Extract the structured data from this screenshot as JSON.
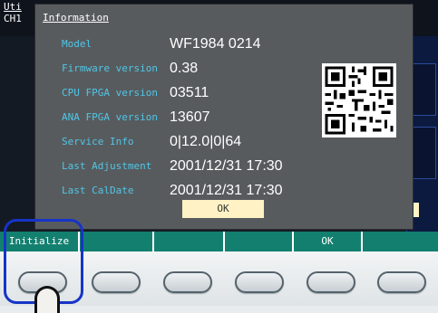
{
  "app": {
    "title": "Uti",
    "channel": "CH1"
  },
  "dialog": {
    "title": "Information",
    "rows": [
      {
        "label": "Model",
        "value": "WF1984  0214"
      },
      {
        "label": "Firmware version",
        "value": "0.38"
      },
      {
        "label": "CPU FPGA version",
        "value": "03511"
      },
      {
        "label": "ANA FPGA version",
        "value": "13607"
      },
      {
        "label": "Service Info",
        "value": "0|12.0|0|64"
      },
      {
        "label": "Last Adjustment",
        "value": "2001/12/31  17:30"
      },
      {
        "label": "Last CalDate",
        "value": "2001/12/31  17:30"
      }
    ],
    "ok_label": "OK"
  },
  "softkeys": [
    "Initialize",
    "",
    "",
    "",
    "OK",
    ""
  ],
  "colors": {
    "label": "#4fc6e6",
    "softkey_bar": "#13806f",
    "highlight": "#1634c8",
    "ok_button": "#fff2c4",
    "dialog_bg": "#585b5e"
  },
  "icons": {
    "qr": "qr-code-icon",
    "finger": "finger-pointer-icon"
  }
}
